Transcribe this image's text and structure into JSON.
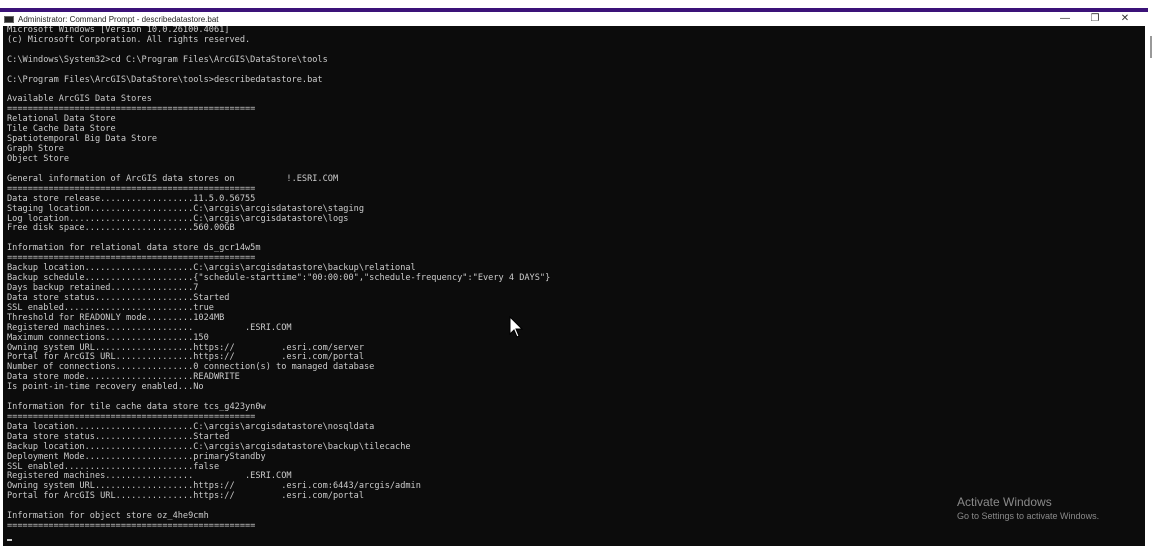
{
  "window": {
    "title": "Administrator: Command Prompt - describedatastore.bat",
    "minimize_icon": "—",
    "maximize_icon": "❐",
    "close_icon": "✕"
  },
  "console": {
    "lines": [
      "Microsoft Windows [Version 10.0.26100.4061]",
      "(c) Microsoft Corporation. All rights reserved.",
      "",
      "C:\\Windows\\System32>cd C:\\Program Files\\ArcGIS\\DataStore\\tools",
      "",
      "C:\\Program Files\\ArcGIS\\DataStore\\tools>describedatastore.bat",
      "",
      "Available ArcGIS Data Stores",
      "================================================",
      "Relational Data Store",
      "Tile Cache Data Store",
      "Spatiotemporal Big Data Store",
      "Graph Store",
      "Object Store",
      "",
      "General information of ArcGIS data stores on          !.ESRI.COM",
      "================================================",
      "Data store release..................11.5.0.56755",
      "Staging location....................C:\\arcgis\\arcgisdatastore\\staging",
      "Log location........................C:\\arcgis\\arcgisdatastore\\logs",
      "Free disk space.....................560.00GB",
      "",
      "Information for relational data store ds_gcr14w5m",
      "================================================",
      "Backup location.....................C:\\arcgis\\arcgisdatastore\\backup\\relational",
      "Backup schedule.....................{\"schedule-starttime\":\"00:00:00\",\"schedule-frequency\":\"Every 4 DAYS\"}",
      "Days backup retained................7",
      "Data store status...................Started",
      "SSL enabled.........................true",
      "Threshold for READONLY mode.........1024MB",
      "Registered machines.................          .ESRI.COM",
      "Maximum connections.................150",
      "Owning system URL...................https://         .esri.com/server",
      "Portal for ArcGIS URL...............https://         .esri.com/portal",
      "Number of connections...............0 connection(s) to managed database",
      "Data store mode.....................READWRITE",
      "Is point-in-time recovery enabled...No",
      "",
      "Information for tile cache data store tcs_g423yn0w",
      "================================================",
      "Data location.......................C:\\arcgis\\arcgisdatastore\\nosqldata",
      "Data store status...................Started",
      "Backup location.....................C:\\arcgis\\arcgisdatastore\\backup\\tilecache",
      "Deployment Mode.....................primaryStandby",
      "SSL enabled.........................false",
      "Registered machines.................          .ESRI.COM",
      "Owning system URL...................https://         .esri.com:6443/arcgis/admin",
      "Portal for ArcGIS URL...............https://         .esri.com/portal",
      "",
      "Information for object store oz_4he9cmh",
      "================================================"
    ]
  },
  "watermark": {
    "title": "Activate Windows",
    "subtitle": "Go to Settings to activate Windows."
  }
}
